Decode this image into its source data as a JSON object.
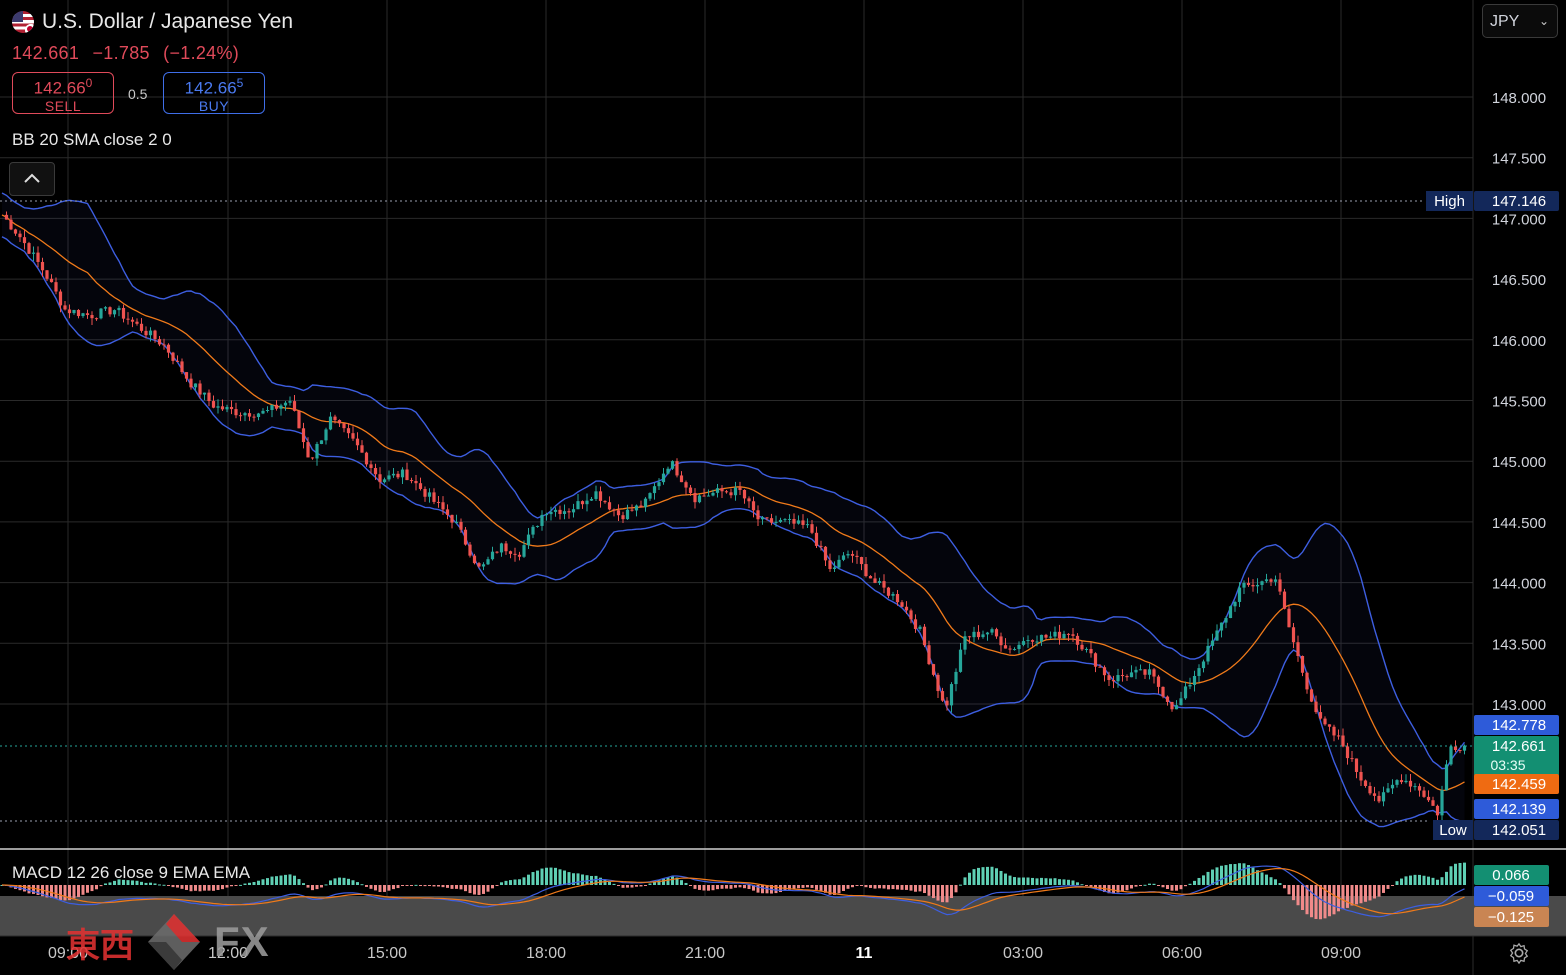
{
  "header": {
    "title": "U.S. Dollar / Japanese Yen",
    "last": "142.661",
    "change": "−1.785",
    "change_pct": "(−1.24%)"
  },
  "trade": {
    "sell_price": "142.66",
    "sell_sup": "0",
    "sell_label": "SELL",
    "spread": "0.5",
    "buy_price": "142.66",
    "buy_sup": "5",
    "buy_label": "BUY"
  },
  "indicator_label": "BB 20 SMA close 2 0",
  "macd_label": "MACD 12 26 close 9 EMA EMA",
  "currency": "JPY",
  "watermark": {
    "kanji": "東西",
    "fx": "FX"
  },
  "colors": {
    "up": "#26a69a",
    "down": "#ef5350",
    "bb": "#3d5ee0",
    "basis": "#f07a1a",
    "grid": "#2a2a2a",
    "high_tag": "#13285a",
    "macd_signal": "#f07a1a",
    "macd_line": "#3d5ee0"
  },
  "chart_data": {
    "type": "line",
    "title": "U.S. Dollar / Japanese Yen",
    "x_ticks": [
      "09:00",
      "12:00",
      "15:00",
      "18:00",
      "21:00",
      "11",
      "03:00",
      "06:00",
      "09:00"
    ],
    "y_ticks": [
      148.0,
      147.5,
      147.0,
      146.5,
      146.0,
      145.5,
      145.0,
      144.5,
      144.0,
      143.5,
      143.0
    ],
    "ylim": [
      141.8,
      148.3
    ],
    "grid": true,
    "price_path": [
      [
        0,
        147.05
      ],
      [
        20,
        146.85
      ],
      [
        45,
        146.55
      ],
      [
        65,
        146.25
      ],
      [
        90,
        146.2
      ],
      [
        115,
        146.25
      ],
      [
        140,
        146.1
      ],
      [
        165,
        145.95
      ],
      [
        190,
        145.65
      ],
      [
        215,
        145.45
      ],
      [
        240,
        145.4
      ],
      [
        265,
        145.4
      ],
      [
        290,
        145.5
      ],
      [
        310,
        145.0
      ],
      [
        330,
        145.35
      ],
      [
        355,
        145.15
      ],
      [
        380,
        144.85
      ],
      [
        405,
        144.9
      ],
      [
        430,
        144.7
      ],
      [
        455,
        144.5
      ],
      [
        480,
        144.1
      ],
      [
        500,
        144.3
      ],
      [
        520,
        144.25
      ],
      [
        545,
        144.6
      ],
      [
        570,
        144.6
      ],
      [
        595,
        144.75
      ],
      [
        620,
        144.55
      ],
      [
        645,
        144.65
      ],
      [
        670,
        145.0
      ],
      [
        695,
        144.7
      ],
      [
        720,
        144.75
      ],
      [
        740,
        144.75
      ],
      [
        760,
        144.5
      ],
      [
        785,
        144.5
      ],
      [
        810,
        144.45
      ],
      [
        830,
        144.1
      ],
      [
        850,
        144.25
      ],
      [
        875,
        144.0
      ],
      [
        900,
        143.85
      ],
      [
        920,
        143.6
      ],
      [
        945,
        142.95
      ],
      [
        965,
        143.55
      ],
      [
        990,
        143.6
      ],
      [
        1010,
        143.45
      ],
      [
        1030,
        143.55
      ],
      [
        1050,
        143.55
      ],
      [
        1070,
        143.6
      ],
      [
        1090,
        143.4
      ],
      [
        1110,
        143.2
      ],
      [
        1130,
        143.25
      ],
      [
        1150,
        143.25
      ],
      [
        1175,
        142.95
      ],
      [
        1195,
        143.25
      ],
      [
        1215,
        143.55
      ],
      [
        1240,
        143.95
      ],
      [
        1260,
        144.0
      ],
      [
        1275,
        144.05
      ],
      [
        1290,
        143.6
      ],
      [
        1305,
        143.2
      ],
      [
        1320,
        142.85
      ],
      [
        1340,
        142.7
      ],
      [
        1360,
        142.4
      ],
      [
        1380,
        142.2
      ],
      [
        1400,
        142.4
      ],
      [
        1420,
        142.3
      ],
      [
        1438,
        142.1
      ],
      [
        1450,
        142.65
      ],
      [
        1468,
        142.661
      ]
    ],
    "series": [
      {
        "values": [
          147.146,
          142.051,
          142.778,
          142.661,
          142.459,
          142.139
        ]
      }
    ],
    "price_labels": [
      {
        "label": "High",
        "value": "147.146",
        "price": 147.146,
        "bg": "#13285a"
      },
      {
        "label": "",
        "value": "142.778",
        "price": 142.778,
        "bg": "#2e5bd9"
      },
      {
        "label": "",
        "value": "142.661",
        "sub": "03:35",
        "price": 142.661,
        "bg": "#138f72"
      },
      {
        "label": "",
        "value": "142.459",
        "price": 142.459,
        "bg": "#ef6b12"
      },
      {
        "label": "",
        "value": "142.139",
        "price": 142.139,
        "bg": "#2e5bd9"
      },
      {
        "label": "Low",
        "value": "142.051",
        "price": 142.051,
        "bg": "#13285a"
      }
    ],
    "macd_values": [
      {
        "value": "0.066",
        "bg": "#138f72"
      },
      {
        "value": "−0.059",
        "bg": "#2e5bd9"
      },
      {
        "value": "−0.125",
        "bg": "#c98553"
      }
    ]
  }
}
